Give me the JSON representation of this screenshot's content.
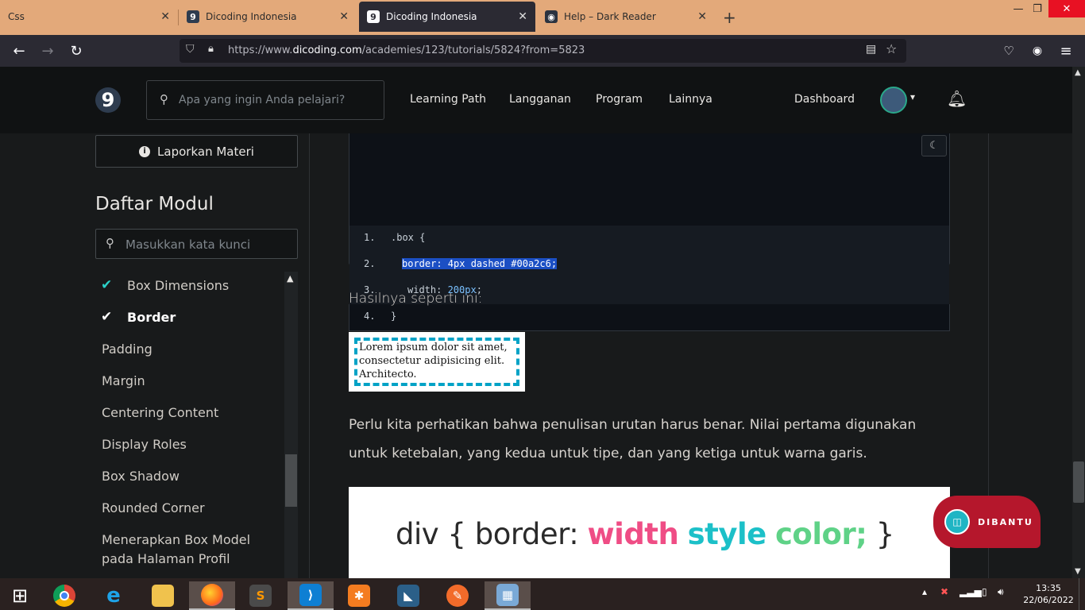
{
  "browser": {
    "tabs": [
      {
        "title": "Css",
        "favicon": "",
        "active": false
      },
      {
        "title": "Dicoding Indonesia",
        "favicon": "9",
        "active": false
      },
      {
        "title": "Dicoding Indonesia",
        "favicon": "9",
        "active": true
      },
      {
        "title": "Help – Dark Reader",
        "favicon": "dark-reader-icon",
        "active": false
      }
    ],
    "url_prefix": "https://www.",
    "url_domain": "dicoding.com",
    "url_path": "/academies/123/tutorials/5824?from=5823"
  },
  "site": {
    "logo": "9",
    "search_placeholder": "Apa yang ingin Anda pelajari?",
    "menu": [
      "Learning Path",
      "Langganan",
      "Program",
      "Lainnya"
    ],
    "dashboard_label": "Dashboard"
  },
  "sidebar": {
    "report_label": "Laporkan Materi",
    "module_title": "Daftar Modul",
    "module_search_placeholder": "Masukkan kata kunci",
    "items": [
      {
        "label": "Box Dimensions",
        "done": true,
        "current": false
      },
      {
        "label": "Border",
        "done": true,
        "current": true
      },
      {
        "label": "Padding",
        "done": false,
        "current": false
      },
      {
        "label": "Margin",
        "done": false,
        "current": false
      },
      {
        "label": "Centering Content",
        "done": false,
        "current": false
      },
      {
        "label": "Display Roles",
        "done": false,
        "current": false
      },
      {
        "label": "Box Shadow",
        "done": false,
        "current": false
      },
      {
        "label": "Rounded Corner",
        "done": false,
        "current": false
      },
      {
        "label": "Menerapkan Box Model pada Halaman Profil",
        "done": false,
        "current": false
      }
    ]
  },
  "content": {
    "code_lines": [
      {
        "n": "1.",
        "text": ".box {"
      },
      {
        "n": "2.",
        "text": "border: 4px dashed #00a2c6;",
        "selected": true
      },
      {
        "n": "3.",
        "prop": "width: ",
        "value": "200px",
        "end": ";"
      },
      {
        "n": "4.",
        "text": "}"
      }
    ],
    "result_intro": "Hasilnya seperti ini:",
    "demo_text": "Lorem ipsum dolor sit amet, consectetur adipisicing elit. Architecto.",
    "explanation": "Perlu kita perhatikan bahwa penulisan urutan harus benar. Nilai pertama digunakan untuk ketebalan, yang kedua untuk tipe, dan yang ketiga untuk warna garis.",
    "banner": {
      "prefix": "div { border: ",
      "width": "width",
      "style": "style",
      "color": "color;",
      "suffix": " }"
    }
  },
  "chat_widget": {
    "label": "DIBANTU"
  },
  "taskbar": {
    "apps": [
      "windows-start",
      "chrome",
      "internet-explorer",
      "file-explorer",
      "firefox",
      "sublime-text",
      "vscode",
      "xampp",
      "mysql-workbench",
      "pencil",
      "control-panel"
    ],
    "time": "13:35",
    "date": "22/06/2022"
  },
  "colors": {
    "accent_border": "#00a2c6",
    "width_color": "#ef4d85",
    "style_color": "#1cc0c8",
    "color_color": "#5fd287",
    "widget": "#b5172c"
  }
}
